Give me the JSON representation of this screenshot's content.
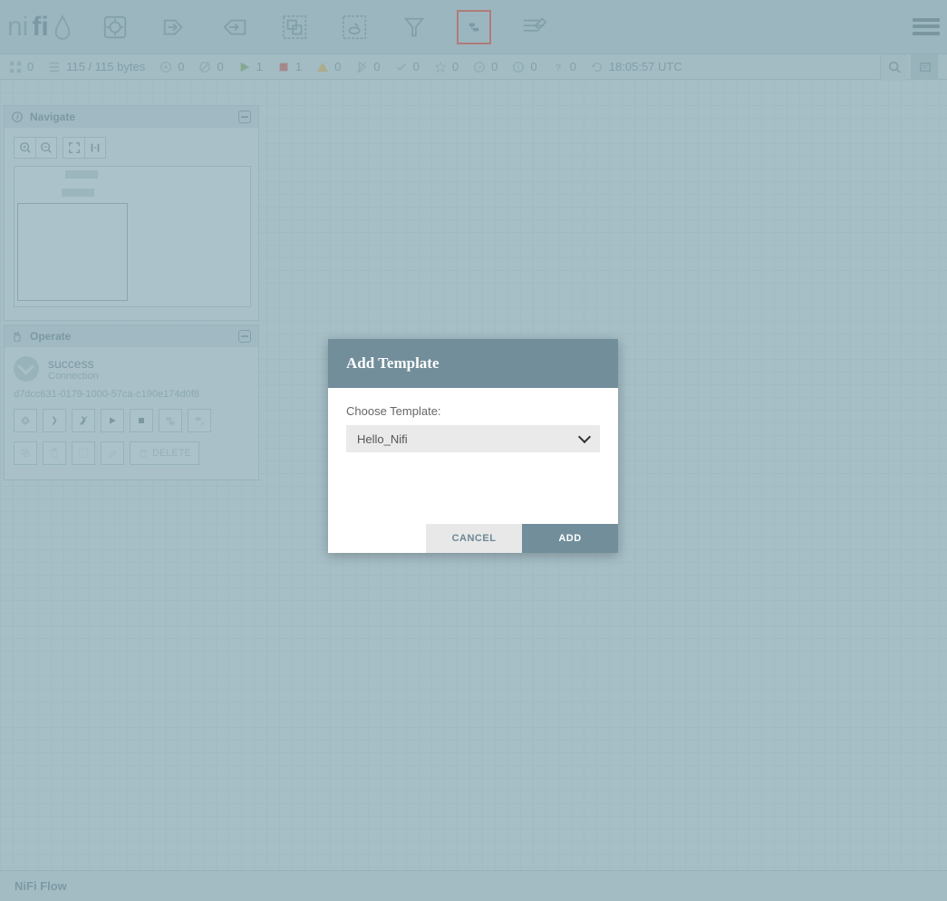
{
  "logo": {
    "text1": "ni",
    "text2": "fi"
  },
  "status": {
    "groups": "0",
    "queued": "115 / 115 bytes",
    "transmitting": "0",
    "notTransmitting": "0",
    "running": "1",
    "stopped": "1",
    "invalid": "0",
    "disabled": "0",
    "uptodate": "0",
    "locallyModified": "0",
    "stale": "0",
    "sync": "0",
    "refreshTime": "18:05:57 UTC"
  },
  "panels": {
    "navigate": {
      "title": "Navigate"
    },
    "operate": {
      "title": "Operate",
      "name": "success",
      "type": "Connection",
      "id": "d7dcc631-0179-1000-57ca-c190e174d0f8",
      "deleteLabel": "DELETE"
    }
  },
  "modal": {
    "title": "Add Template",
    "fieldLabel": "Choose Template:",
    "selected": "Hello_Nifi",
    "cancel": "CANCEL",
    "add": "ADD"
  },
  "footer": {
    "breadcrumb": "NiFi Flow"
  }
}
